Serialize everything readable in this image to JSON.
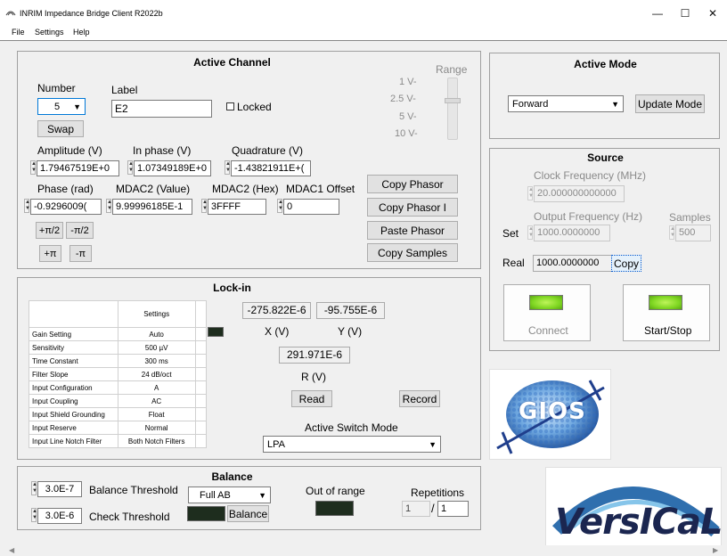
{
  "window": {
    "title": "INRIM Impedance Bridge Client R2022b",
    "minimize": "—",
    "maximize": "☐",
    "close": "✕"
  },
  "menu": [
    "File",
    "Settings",
    "Help"
  ],
  "active_channel": {
    "title": "Active Channel",
    "number_label": "Number",
    "number_value": "5",
    "label_label": "Label",
    "label_value": "E2",
    "locked_label": "Locked",
    "swap_label": "Swap",
    "amplitude_label": "Amplitude (V)",
    "amplitude_value": "1.79467519E+0",
    "inphase_label": "In phase (V)",
    "inphase_value": "1.07349189E+0",
    "quadrature_label": "Quadrature (V)",
    "quadrature_value": "-1.43821911E+(",
    "phase_label": "Phase (rad)",
    "phase_value": "-0.9296009(",
    "mdac2_value_label": "MDAC2 (Value)",
    "mdac2_value": "9.99996185E-1",
    "mdac2_hex_label": "MDAC2 (Hex)",
    "mdac2_hex": "3FFFF",
    "mdac1_offset_label": "MDAC1 Offset",
    "mdac1_offset": "0",
    "btn_plus_pi2": "+π/2",
    "btn_minus_pi2": "-π/2",
    "btn_plus_pi": "+π",
    "btn_minus_pi": "-π",
    "copy_phasor": "Copy Phasor",
    "copy_phasor_i": "Copy Phasor I",
    "paste_phasor": "Paste Phasor",
    "copy_samples": "Copy Samples",
    "range_label": "Range",
    "range_ticks": [
      "1 V-",
      "2.5 V-",
      "5 V-",
      "10 V-"
    ]
  },
  "active_mode": {
    "title": "Active Mode",
    "mode_value": "Forward",
    "update_mode": "Update Mode"
  },
  "source": {
    "title": "Source",
    "clock_label": "Clock Frequency (MHz)",
    "clock_value": "20.000000000000",
    "output_label": "Output Frequency (Hz)",
    "samples_label": "Samples",
    "set_label": "Set",
    "set_value": "1000.0000000",
    "samples_value": "500",
    "real_label": "Real",
    "real_value": "1000.0000000",
    "copy_label": "Copy",
    "connect_label": "Connect",
    "startstop_label": "Start/Stop"
  },
  "lockin": {
    "title": "Lock-in",
    "settings_header": "Settings",
    "settings": [
      {
        "name": "Gain Setting",
        "value": "Auto"
      },
      {
        "name": "Sensitivity",
        "value": "500 µV"
      },
      {
        "name": "Time Constant",
        "value": "300 ms"
      },
      {
        "name": "Filter Slope",
        "value": "24 dB/oct"
      },
      {
        "name": "Input Configuration",
        "value": "A"
      },
      {
        "name": "Input Coupling",
        "value": "AC"
      },
      {
        "name": "Input Shield Grounding",
        "value": "Float"
      },
      {
        "name": "Input Reserve",
        "value": "Normal"
      },
      {
        "name": "Input Line Notch Filter",
        "value": "Both Notch Filters"
      }
    ],
    "x_value": "-275.822E-6",
    "y_value": "-95.755E-6",
    "x_label": "X (V)",
    "y_label": "Y (V)",
    "r_value": "291.971E-6",
    "r_label": "R (V)",
    "read_label": "Read",
    "record_label": "Record",
    "switch_mode_label": "Active Switch Mode",
    "switch_mode_value": "LPA"
  },
  "balance": {
    "title": "Balance",
    "balance_threshold_value": "3.0E-7",
    "balance_threshold_label": "Balance Threshold",
    "check_threshold_value": "3.0E-6",
    "check_threshold_label": "Check Threshold",
    "mode_value": "Full AB",
    "balance_button": "Balance",
    "out_of_range_label": "Out of range",
    "repetitions_label": "Repetitions",
    "rep_current": "1",
    "rep_total": "1"
  },
  "logos": {
    "gios_text": "GIOS",
    "versical_text": "VersICaL"
  }
}
